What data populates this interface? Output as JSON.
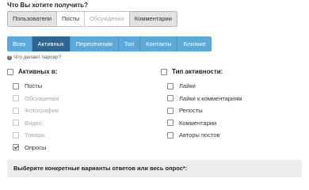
{
  "question": "Что Вы хотите получить?",
  "segments": [
    {
      "label": "Пользователи",
      "state": "active"
    },
    {
      "label": "Посты",
      "state": "normal"
    },
    {
      "label": "Обсуждения",
      "state": "disabled"
    },
    {
      "label": "Комментарии",
      "state": "active"
    }
  ],
  "tabs": [
    {
      "label": "Всех",
      "active": false
    },
    {
      "label": "Активных",
      "active": true
    },
    {
      "label": "Пересечения",
      "active": false
    },
    {
      "label": "Топ",
      "active": false
    },
    {
      "label": "Контакты",
      "active": false
    },
    {
      "label": "Близкие",
      "active": false
    }
  ],
  "help": {
    "icon": "question-circle-icon",
    "text": "Что делает парсер?"
  },
  "left_column": {
    "title": "Активных в:",
    "items": [
      {
        "label": "Посты",
        "checked": false,
        "disabled": false
      },
      {
        "label": "Обсуждения",
        "checked": false,
        "disabled": true
      },
      {
        "label": "Фотографии",
        "checked": false,
        "disabled": true
      },
      {
        "label": "Видео",
        "checked": false,
        "disabled": true
      },
      {
        "label": "Товары",
        "checked": false,
        "disabled": true
      },
      {
        "label": "Опросы",
        "checked": true,
        "disabled": false
      }
    ]
  },
  "right_column": {
    "title": "Тип активности:",
    "items": [
      {
        "label": "Лайки",
        "checked": false
      },
      {
        "label": "Лайки к комментариям",
        "checked": false
      },
      {
        "label": "Репосты",
        "checked": false
      },
      {
        "label": "Комментарии",
        "checked": false
      },
      {
        "label": "Авторы постов",
        "checked": false
      }
    ]
  },
  "bottom": {
    "text": "Выберите конкретные варианты ответов или весь опрос*:"
  },
  "colors": {
    "tab_bg": "#5ba9d9",
    "tab_active_bg": "#2e6592",
    "bottom_bar_bg": "#ececec"
  }
}
